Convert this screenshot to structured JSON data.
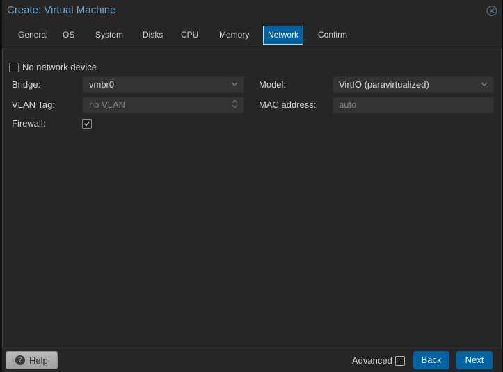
{
  "dialog": {
    "title": "Create: Virtual Machine"
  },
  "tabs": [
    {
      "label": "General",
      "active": false
    },
    {
      "label": "OS",
      "active": false
    },
    {
      "label": "System",
      "active": false
    },
    {
      "label": "Disks",
      "active": false
    },
    {
      "label": "CPU",
      "active": false
    },
    {
      "label": "Memory",
      "active": false
    },
    {
      "label": "Network",
      "active": true
    },
    {
      "label": "Confirm",
      "active": false
    }
  ],
  "form": {
    "no_network_device": {
      "label": "No network device",
      "checked": false
    },
    "bridge": {
      "label": "Bridge:",
      "value": "vmbr0"
    },
    "vlan": {
      "label": "VLAN Tag:",
      "placeholder": "no VLAN",
      "disabled": true
    },
    "firewall": {
      "label": "Firewall:",
      "checked": true
    },
    "model": {
      "label": "Model:",
      "value": "VirtIO (paravirtualized)"
    },
    "mac": {
      "label": "MAC address:",
      "placeholder": "auto"
    }
  },
  "footer": {
    "help": "Help",
    "advanced": "Advanced",
    "back": "Back",
    "next": "Next"
  },
  "colors": {
    "accent": "#0062a1",
    "title_blue": "#74a3ca",
    "field_bg": "#333333"
  }
}
